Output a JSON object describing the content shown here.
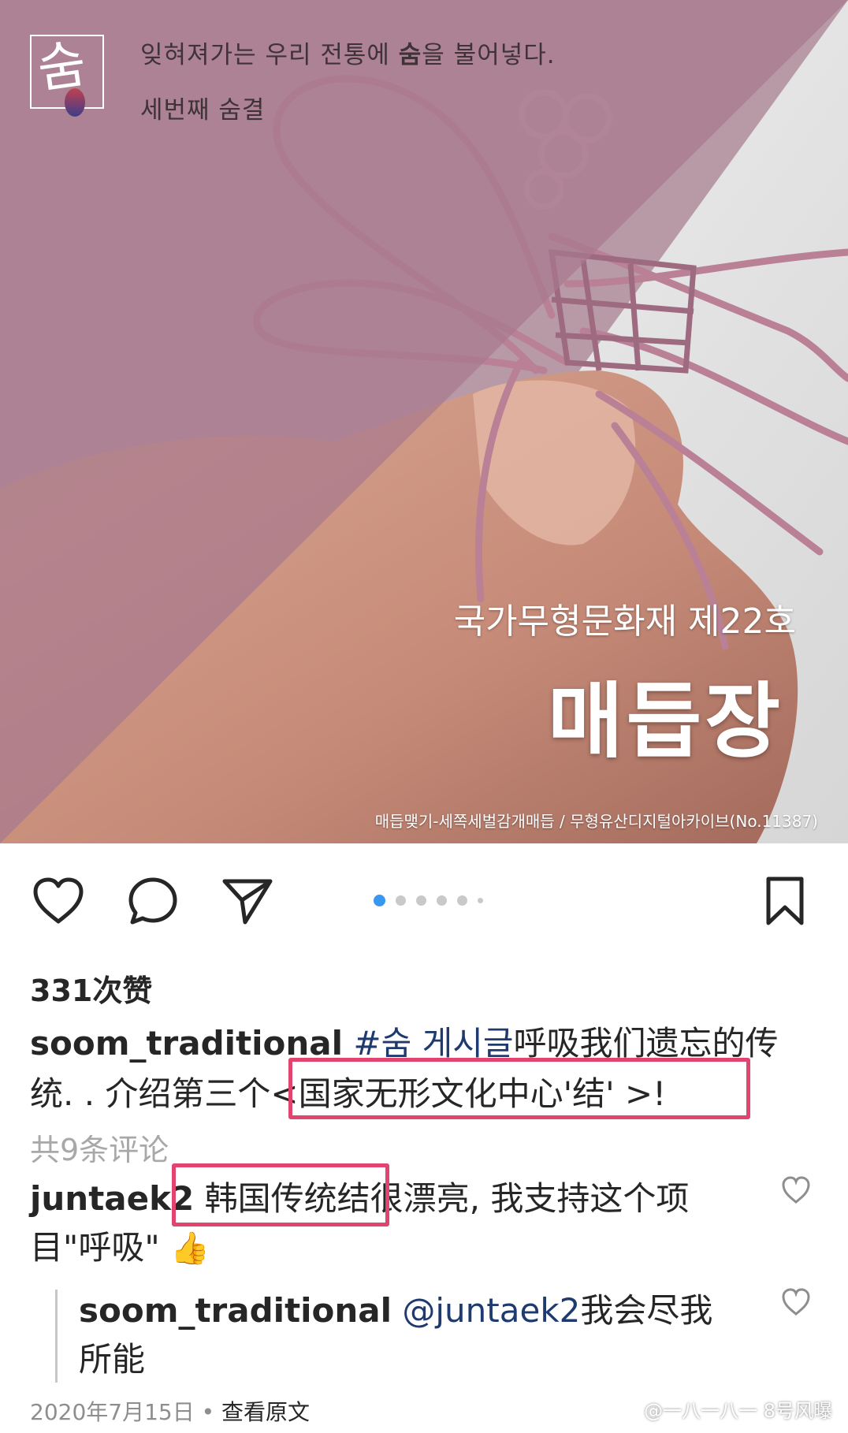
{
  "post_image": {
    "tagline_before": "잊혀져가는 우리 전통에 ",
    "tagline_bold": "숨",
    "tagline_after": "을 불어넣다.",
    "subtitle": "세번째 숨결",
    "logo_glyph": "숨",
    "heritage_number": "국가무형문화재 제22호",
    "heritage_name": "매듭장",
    "caption": "매듭맺기-세쪽세벌감개매듭 / 무형유산디지털아카이브(No.11387)"
  },
  "action_bar": {
    "like_icon": "heart-icon",
    "comment_icon": "comment-bubble-icon",
    "share_icon": "paper-plane-icon",
    "save_icon": "bookmark-icon",
    "carousel_active_index": 0,
    "accent_color": "#3897f0"
  },
  "likes": "331次赞",
  "caption": {
    "username": "soom_traditional",
    "hashtag_prefix": " #숨 게시글",
    "text_part1": "呼吸我们遗忘的传统. . 介绍第三个",
    "highlight": "<国家无形文化中心'结' >!"
  },
  "view_comments": "共9条评论",
  "comment": {
    "username": "juntaek2",
    "highlight": "韩国传统结",
    "text": "很漂亮, 我支持这个项目\"呼吸\"",
    "emoji": "👍"
  },
  "reply": {
    "username": "soom_traditional",
    "mention": "@juntaek2",
    "text": "我会尽我所能"
  },
  "timestamp": {
    "date": "2020年7月15日",
    "separator": " • ",
    "link": "查看原文"
  },
  "watermark": "@一八一八一  8号风曝",
  "highlight_color": "#e0446f"
}
